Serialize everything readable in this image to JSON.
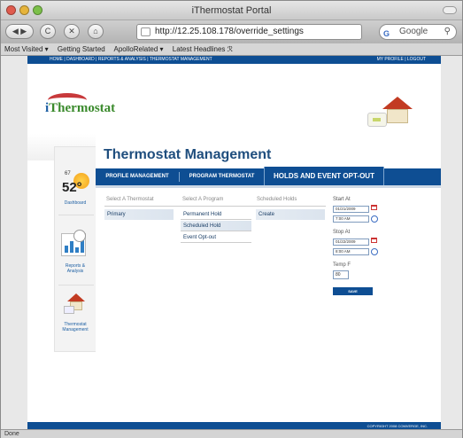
{
  "window": {
    "title": "iThermostat Portal"
  },
  "toolbar": {
    "url": "http://12.25.108.178/override_settings",
    "search_placeholder": "Google",
    "search_engine_letter": "G",
    "rss": "☆ ▾ ·"
  },
  "bookmarks": [
    "Most Visited ▾",
    "Getting Started",
    "ApolloRelated ▾",
    "Latest Headlines ℛ"
  ],
  "topnav": {
    "left": "HOME  |  DASHBOARD  |  REPORTS & ANALYSIS  |  THERMOSTAT MANAGEMENT",
    "right": "MY PROFILE  |  LOGOUT"
  },
  "logo": {
    "brand_i": "i",
    "brand_rest": "Thermostat"
  },
  "sidebar": {
    "weather_temp": "67",
    "weather_big": "52°",
    "dashboard_label": "Dashboard",
    "reports_label": "Reports & Analysis",
    "thermostat_label": "Thermostat Management"
  },
  "main": {
    "title": "Thermostat Management",
    "tabs": [
      {
        "label": "PROFILE MANAGEMENT"
      },
      {
        "label": "PROGRAM THERMOSTAT"
      },
      {
        "label": "HOLDS AND EVENT OPT-OUT"
      }
    ],
    "columns": {
      "thermostat": "Select A Thermostat",
      "program": "Select A Program",
      "holds": "Scheduled Holds"
    },
    "thermostats": [
      "Primary"
    ],
    "programs": [
      "Permanent Hold",
      "Scheduled Hold",
      "Event Opt-out"
    ],
    "holds": [
      "Create"
    ],
    "start_label": "Start At",
    "start_date": "01/21/2009",
    "start_time": "7:00 AM",
    "stop_label": "Stop At",
    "stop_date": "01/22/2009",
    "stop_time": "8:00 AM",
    "temp_label": "Temp F",
    "temp_value": "80",
    "save_label": "SAVE"
  },
  "footer": {
    "copyright": "COPYRIGHT 2008 COMVERGE, INC."
  },
  "status": {
    "text": "Done"
  }
}
